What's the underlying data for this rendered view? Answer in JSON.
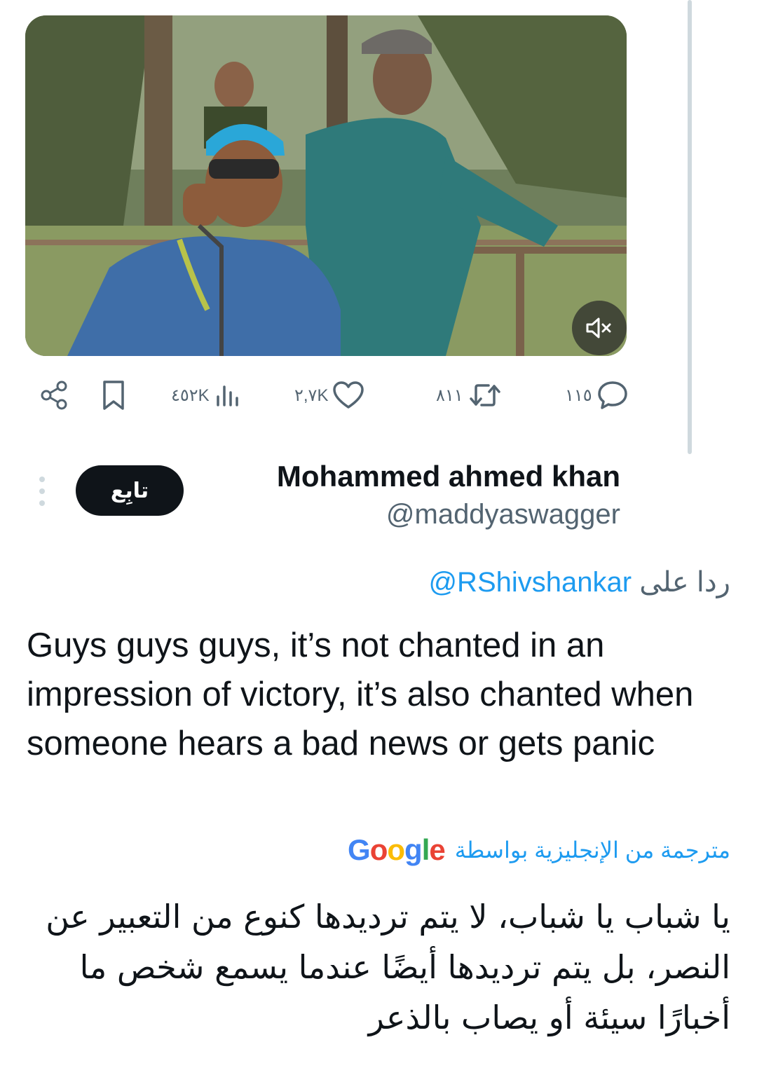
{
  "video": {
    "muted": true
  },
  "icons": {
    "share": "share-icon",
    "bookmark": "bookmark-icon",
    "views": "views-icon",
    "like": "heart-icon",
    "retweet": "retweet-icon",
    "reply": "reply-icon",
    "mute": "speaker-muted-icon",
    "more": "more-vertical-icon"
  },
  "tweet_actions": {
    "views": "٤٥٢K",
    "likes": "٢,٧K",
    "retweets": "٨١١",
    "replies": "١١٥"
  },
  "author": {
    "name": "Mohammed ahmed khan",
    "handle": "@maddyaswagger",
    "follow_label": "تابِع"
  },
  "reply": {
    "prefix": "ردا على",
    "mention": "@RShivshankar"
  },
  "tweet": {
    "text": "Guys guys guys, it’s not chanted in an impression of victory, it’s also chanted when someone hears a bad news or gets panic"
  },
  "translation": {
    "label": "مترجمة من الإنجليزية بواسطة",
    "provider": "Google",
    "text": "يا شباب يا شباب، لا يتم ترديدها كنوع من التعبير عن النصر، بل يتم ترديدها أيضًا عندما يسمع شخص ما أخبارًا سيئة أو يصاب بالذعر"
  },
  "colors": {
    "text": "#0f1419",
    "muted": "#536471",
    "link": "#1d9bf0",
    "follow_bg": "#0f1419",
    "thread_line": "#cfd9de"
  }
}
